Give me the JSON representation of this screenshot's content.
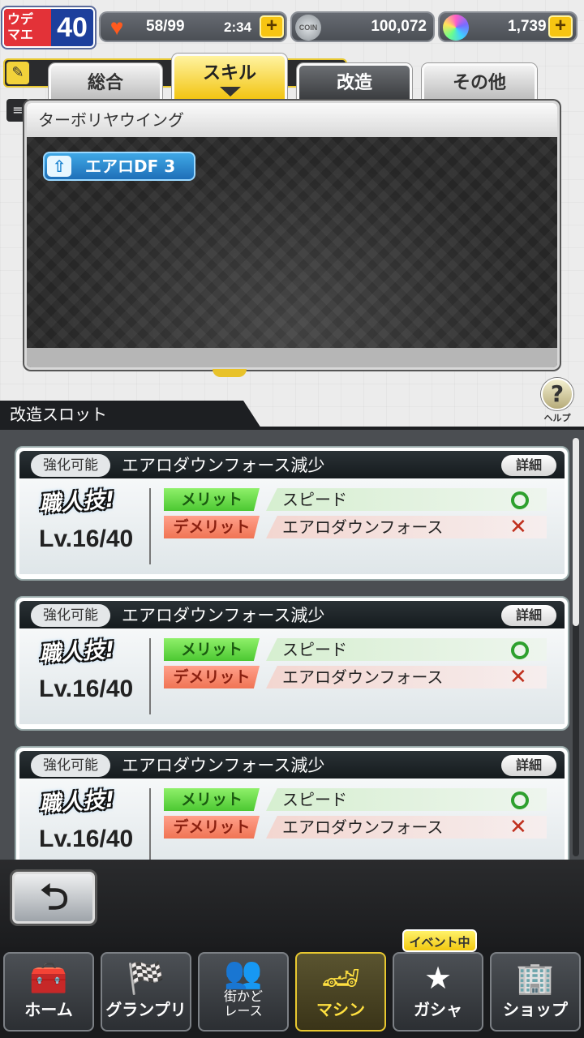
{
  "status": {
    "rank_label": "ウデ\nマエ",
    "rank_value": "40",
    "stamina": "58/99",
    "timer": "2:34",
    "coins": "100,072",
    "gems": "1,739"
  },
  "tabs": [
    {
      "label": "総合"
    },
    {
      "label": "スキル"
    },
    {
      "label": "改造"
    },
    {
      "label": "その他"
    }
  ],
  "modal": {
    "title": "ターボリヤウイング",
    "skill": "エアロDF 3"
  },
  "help_label": "ヘルプ",
  "slot_header": "改造スロット",
  "slots": [
    {
      "badge": "強化可能",
      "title": "エアロダウンフォース減少",
      "detail": "詳細",
      "craft": "職人技!",
      "level": "Lv.16/40",
      "merit_label": "メリット",
      "merit": "スピード",
      "demerit_label": "デメリット",
      "demerit": "エアロダウンフォース"
    },
    {
      "badge": "強化可能",
      "title": "エアロダウンフォース減少",
      "detail": "詳細",
      "craft": "職人技!",
      "level": "Lv.16/40",
      "merit_label": "メリット",
      "merit": "スピード",
      "demerit_label": "デメリット",
      "demerit": "エアロダウンフォース"
    },
    {
      "badge": "強化可能",
      "title": "エアロダウンフォース減少",
      "detail": "詳細",
      "craft": "職人技!",
      "level": "Lv.16/40",
      "merit_label": "メリット",
      "merit": "スピード",
      "demerit_label": "デメリット",
      "demerit": "エアロダウンフォース"
    }
  ],
  "nav": [
    {
      "label": "ホーム",
      "icon": "toolbox-icon"
    },
    {
      "label": "グランプリ",
      "icon": "checkered-flag-icon"
    },
    {
      "label": "街かど\nレース",
      "icon": "people-icon"
    },
    {
      "label": "マシン",
      "icon": "race-car-icon"
    },
    {
      "label": "ガシャ",
      "icon": "star-laurel-icon"
    },
    {
      "label": "ショップ",
      "icon": "building-icon"
    }
  ],
  "event_badge": "イベント中",
  "colors": {
    "accent": "#f7c512",
    "merit": "#4cc832",
    "demerit": "#f07454"
  }
}
